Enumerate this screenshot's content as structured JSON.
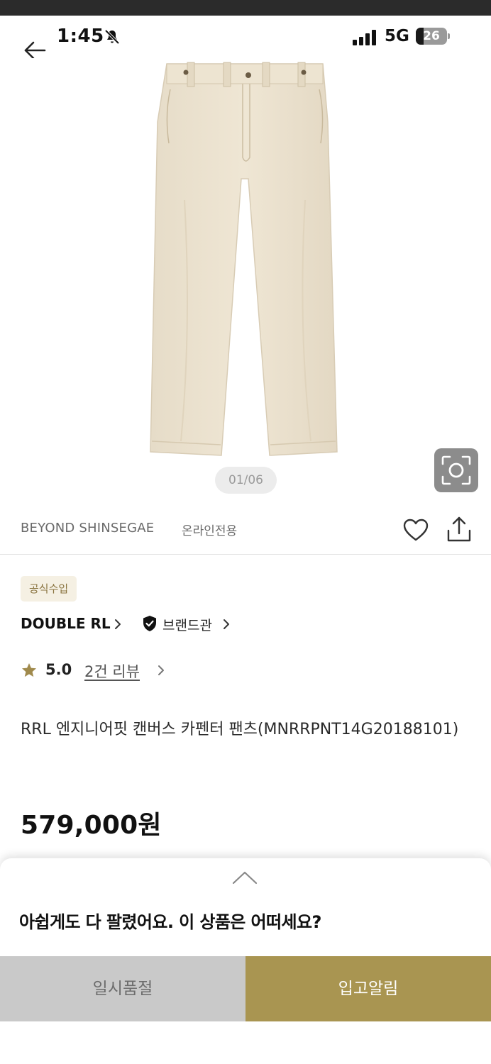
{
  "status_bar": {
    "time": "1:45",
    "network": "5G",
    "battery": "26",
    "battery_level_pct": 26
  },
  "gallery": {
    "counter": "01/06",
    "image_icon": "pants-product-image",
    "camera_icon": "lens-search-icon"
  },
  "seller": {
    "name": "BEYOND SHINSEGAE",
    "tag": "온라인전용"
  },
  "product": {
    "badge": "공식수입",
    "brand": "DOUBLE RL",
    "brand_hall": "브랜드관",
    "rating": "5.0",
    "review_link": "2건 리뷰",
    "title": "RRL 엔지니어핏 캔버스 카펜터 팬츠(MNRRPNT14G20188101)",
    "price": "579,000원"
  },
  "sheet": {
    "message": "아쉽게도 다 팔렸어요. 이 상품은 어떠세요?"
  },
  "actions": {
    "soldout_label": "일시품절",
    "notify_label": "입고알림"
  },
  "colors": {
    "accent_gold": "#a99551",
    "badge_bg": "#f5f0e3",
    "star": "#a08a4c",
    "disabled_bg": "#c9c9c9"
  }
}
